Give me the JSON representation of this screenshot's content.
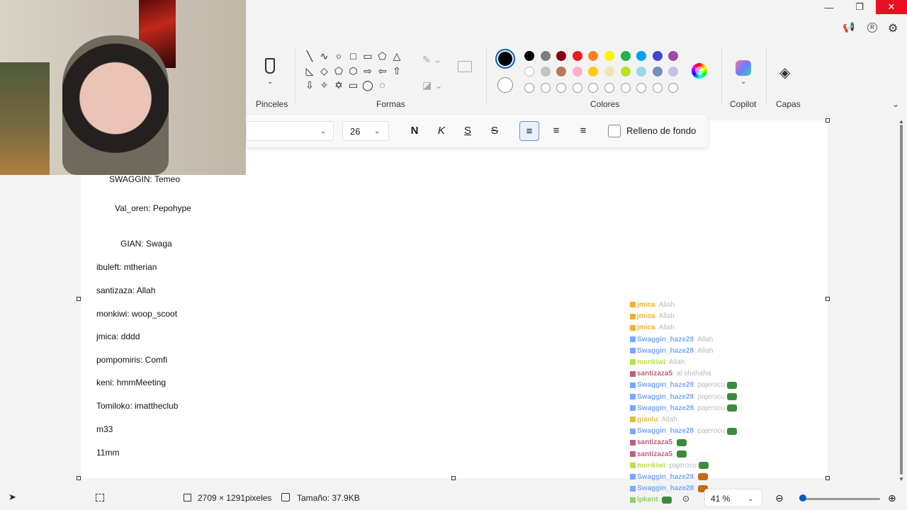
{
  "window": {
    "minimize": "—",
    "maximize": "❐",
    "close": "✕"
  },
  "ribbon": {
    "groups": {
      "brushes": "Pinceles",
      "shapes": "Formas",
      "colors": "Colores",
      "copilot": "Copilot",
      "layers": "Capas"
    },
    "shapes": [
      "╲",
      "∿",
      "○",
      "□",
      "▭",
      "⬠",
      "△",
      "◺",
      "◇",
      "⬠",
      "⬡",
      "⇨",
      "⇦",
      "⇧",
      "⇩",
      "✧",
      "✡",
      "▭",
      "◯",
      "◌"
    ],
    "palette_row1": [
      "#000000",
      "#7f7f7f",
      "#880015",
      "#ed1c24",
      "#ff7f27",
      "#fff200",
      "#22b14c",
      "#00a2e8",
      "#3f48cc",
      "#a349a4"
    ],
    "palette_row2": [
      "#ffffff",
      "#c3c3c3",
      "#b97a57",
      "#ffaec9",
      "#ffc90e",
      "#efe4b0",
      "#b5e61d",
      "#99d9ea",
      "#7092be",
      "#c8bfe7"
    ],
    "selected_color1": "#000000",
    "selected_color2": "#ffffff"
  },
  "text_toolbar": {
    "font_size": "26",
    "bold_label": "N",
    "italic_label": "K",
    "underline_label": "S",
    "strike_label": "S",
    "bg_fill_label": "Relleno de fondo"
  },
  "canvas_lines": [
    "SWAGGIN: Temeo",
    "Val_oren: Pepohype",
    "GIAN: Swaga",
    "ibuleft: mtherian",
    "santizaza: Allah",
    "monkiwi: woop_scoot",
    "jmica: dddd",
    "pompomiris: Comfi",
    "keni: hmmMeeting",
    "Tomiloko: imattheclub",
    "m33",
    "11mm"
  ],
  "overlay_chat": [
    {
      "user": "jmica",
      "msg": ": Allah",
      "color": "#f0b030"
    },
    {
      "user": "jmica",
      "msg": ": Allah",
      "color": "#f0b030"
    },
    {
      "user": "jmica",
      "msg": ": Allah",
      "color": "#f0b030"
    },
    {
      "user": "Swaggin_haze28",
      "msg": ": Allah",
      "color": "#7aa7ff"
    },
    {
      "user": "Swaggin_haze28",
      "msg": ": Allah",
      "color": "#7aa7ff"
    },
    {
      "user": "monkiwi",
      "msg": ": Allah",
      "color": "#b8e04a"
    },
    {
      "user": "santizaza5",
      "msg": ": al shahaha",
      "color": "#c06080"
    },
    {
      "user": "Swaggin_haze28",
      "msg": ": pajerocu",
      "color": "#7aa7ff"
    },
    {
      "user": "Swaggin_haze28",
      "msg": ": pajerocu",
      "color": "#7aa7ff"
    },
    {
      "user": "Swaggin_haze28",
      "msg": ": pajerocu",
      "color": "#7aa7ff"
    },
    {
      "user": "gianlu",
      "msg": ": Allah",
      "color": "#e0c040"
    },
    {
      "user": "Swaggin_haze28",
      "msg": ": pajerocu",
      "color": "#7aa7ff"
    },
    {
      "user": "santizaza5",
      "msg": ":",
      "color": "#c06080"
    },
    {
      "user": "santizaza5",
      "msg": ":",
      "color": "#c06080"
    },
    {
      "user": "monkiwi",
      "msg": ": pajerocu",
      "color": "#b8e04a"
    },
    {
      "user": "Swaggin_haze28",
      "msg": ":",
      "color": "#7aa7ff"
    },
    {
      "user": "Swaggin_haze28",
      "msg": ":",
      "color": "#7aa7ff"
    },
    {
      "user": "lpkent",
      "msg": ":",
      "color": "#90d060"
    }
  ],
  "status": {
    "dimensions": "2709 × 1291pixeles",
    "size": "Tamaño: 37.9KB",
    "zoom": "41 %"
  },
  "icons": {
    "brush": "brush-icon",
    "layers": "layers-icon",
    "copilot": "copilot-icon",
    "settings": "gear-icon"
  }
}
